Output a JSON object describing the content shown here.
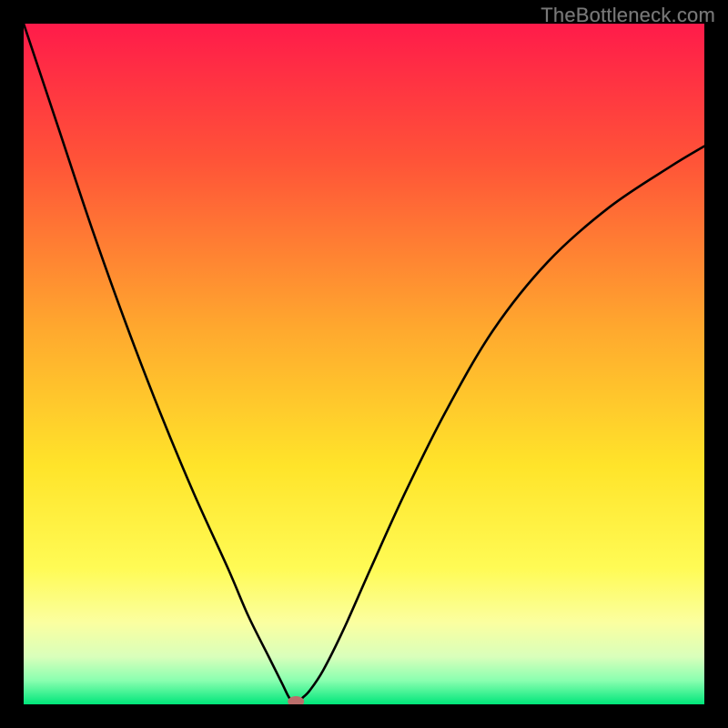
{
  "watermark": "TheBottleneck.com",
  "chart_data": {
    "type": "line",
    "title": "",
    "xlabel": "",
    "ylabel": "",
    "xlim": [
      0,
      100
    ],
    "ylim": [
      0,
      100
    ],
    "series": [
      {
        "name": "curve",
        "x": [
          0,
          5,
          10,
          15,
          20,
          25,
          30,
          33,
          36,
          38,
          39,
          40,
          41,
          42,
          44,
          47,
          51,
          56,
          62,
          69,
          77,
          86,
          95,
          100
        ],
        "y": [
          100,
          85,
          70,
          56,
          43,
          31,
          20,
          13,
          7,
          3,
          1,
          0,
          1,
          2,
          5,
          11,
          20,
          31,
          43,
          55,
          65,
          73,
          79,
          82
        ]
      }
    ],
    "marker": {
      "x": 40,
      "y": 0,
      "color": "#bb6e6b"
    },
    "gradient_stops": [
      {
        "offset": 0.0,
        "color": "#ff1b4a"
      },
      {
        "offset": 0.2,
        "color": "#ff5338"
      },
      {
        "offset": 0.45,
        "color": "#ffa92e"
      },
      {
        "offset": 0.65,
        "color": "#ffe42a"
      },
      {
        "offset": 0.8,
        "color": "#fffb55"
      },
      {
        "offset": 0.88,
        "color": "#fbffa0"
      },
      {
        "offset": 0.93,
        "color": "#d9ffbb"
      },
      {
        "offset": 0.965,
        "color": "#8affb0"
      },
      {
        "offset": 1.0,
        "color": "#00e67a"
      }
    ]
  }
}
